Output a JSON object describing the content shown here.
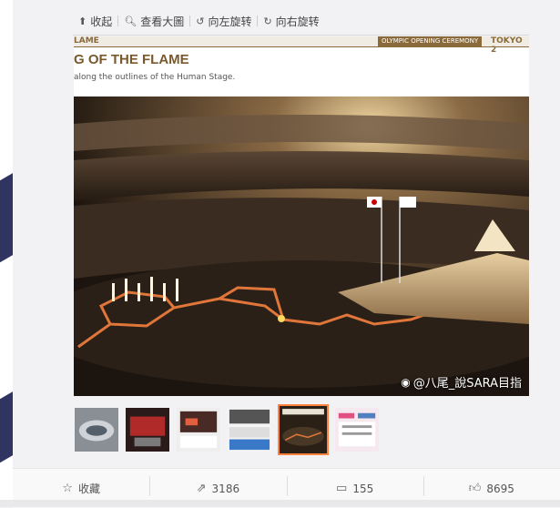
{
  "toolbar": {
    "collapse": {
      "icon": "collapse-icon",
      "label": "收起"
    },
    "view_large": {
      "icon": "search-icon",
      "label": "查看大圖"
    },
    "rotate_left": {
      "icon": "rotate-left-icon",
      "label": "向左旋转"
    },
    "rotate_right": {
      "icon": "rotate-right-icon",
      "label": "向右旋转"
    }
  },
  "photo": {
    "header_left": "LAME",
    "header_center": "OLYMPIC OPENING CEREMONY",
    "header_right": "TOKYO 2",
    "title": "G OF THE FLAME",
    "subtitle": "along the outlines of the Human Stage.",
    "watermark": "@八尾_說SARA目指",
    "watermark_icon": "weibo-icon"
  },
  "thumbnails": [
    {
      "name": "thumb-1",
      "active": false,
      "color": "#6b7a8c"
    },
    {
      "name": "thumb-2",
      "active": false,
      "color": "#9a2a2a"
    },
    {
      "name": "thumb-3",
      "active": false,
      "color": "#c85a3a"
    },
    {
      "name": "thumb-4",
      "active": false,
      "color": "#3a6aa8"
    },
    {
      "name": "thumb-5",
      "active": true,
      "color": "#2a2016"
    },
    {
      "name": "thumb-6",
      "active": false,
      "color": "#e05080"
    }
  ],
  "footer": {
    "favorite": {
      "icon": "star-icon",
      "label": "收藏"
    },
    "share": {
      "icon": "share-icon",
      "label": "3186"
    },
    "comment": {
      "icon": "comment-icon",
      "label": "155"
    },
    "like": {
      "icon": "thumbs-up-icon",
      "label": "8695"
    }
  },
  "colors": {
    "accent": "#ff8140",
    "brand_gold": "#8a6a3a",
    "background": "#f2f2f5"
  }
}
